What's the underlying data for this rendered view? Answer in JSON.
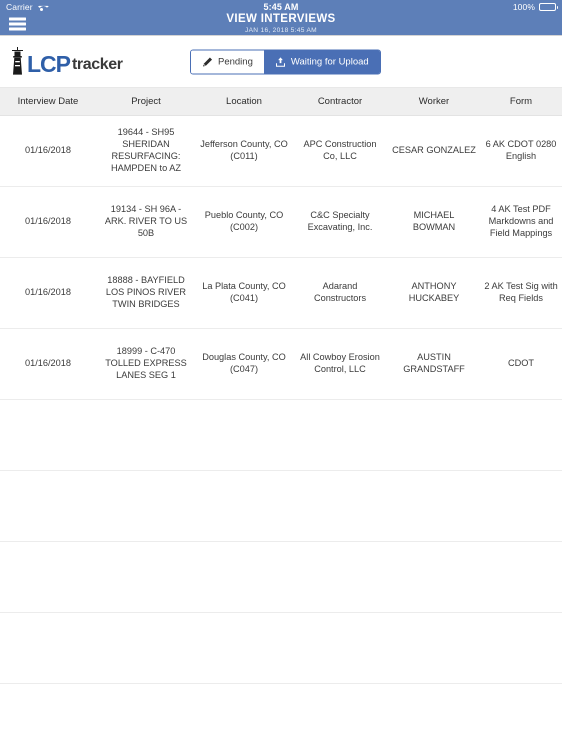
{
  "status_bar": {
    "carrier": "Carrier",
    "wifi_icon": "wifi-icon",
    "time": "5:45 AM",
    "battery_percent": "100%",
    "battery_icon": "battery-full-icon"
  },
  "nav": {
    "menu_icon": "hamburger-menu-icon",
    "title": "VIEW INTERVIEWS",
    "subtitle": "JAN 16, 2018 5:45 AM",
    "background_color": "#5d7fb8"
  },
  "toolbar": {
    "logo": {
      "icon": "lighthouse-icon",
      "primary": "LCP",
      "secondary": "tracker",
      "primary_color": "#2f5fa8",
      "secondary_color": "#3a3a3a"
    },
    "segmented_control": {
      "accent_color": "#4a6fb5",
      "buttons": [
        {
          "label": "Pending",
          "icon": "pencil-icon",
          "active": false
        },
        {
          "label": "Waiting for Upload",
          "icon": "upload-icon",
          "active": true
        }
      ]
    }
  },
  "table": {
    "columns": [
      "Interview Date",
      "Project",
      "Location",
      "Contractor",
      "Worker",
      "Form"
    ],
    "rows": [
      {
        "interview_date": "01/16/2018",
        "project": "19644 - SH95 SHERIDAN RESURFACING: HAMPDEN to AZ",
        "location": "Jefferson County, CO (C011)",
        "contractor": "APC Construction Co, LLC",
        "worker": "CESAR GONZALEZ",
        "form": "6 AK CDOT 0280 English"
      },
      {
        "interview_date": "01/16/2018",
        "project": "19134 - SH 96A - ARK. RIVER TO US 50B",
        "location": "Pueblo County, CO (C002)",
        "contractor": "C&C Specialty Excavating, Inc.",
        "worker": "MICHAEL BOWMAN",
        "form": "4 AK Test PDF Markdowns and Field Mappings"
      },
      {
        "interview_date": "01/16/2018",
        "project": "18888 - BAYFIELD LOS PINOS RIVER TWIN BRIDGES",
        "location": "La Plata County, CO (C041)",
        "contractor": "Adarand Constructors",
        "worker": "ANTHONY HUCKABEY",
        "form": "2 AK Test Sig with Req Fields"
      },
      {
        "interview_date": "01/16/2018",
        "project": "18999 - C-470 TOLLED EXPRESS LANES SEG 1",
        "location": "Douglas County, CO (C047)",
        "contractor": "All Cowboy Erosion Control, LLC",
        "worker": "AUSTIN GRANDSTAFF",
        "form": "CDOT"
      }
    ],
    "empty_row_count": 5
  }
}
